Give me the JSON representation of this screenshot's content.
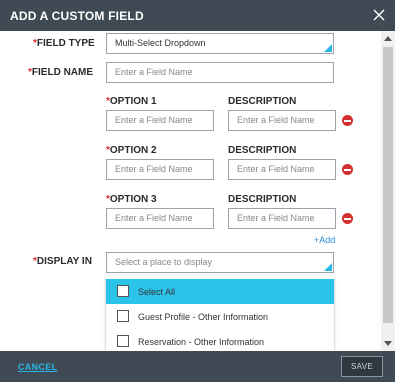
{
  "dialog": {
    "title": "ADD A CUSTOM FIELD"
  },
  "form": {
    "field_type": {
      "label": "FIELD TYPE",
      "value": "Multi-Select Dropdown"
    },
    "field_name": {
      "label": "FIELD NAME",
      "placeholder": "Enter a Field Name"
    },
    "options": [
      {
        "label": "OPTION 1",
        "desc_label": "DESCRIPTION",
        "placeholder": "Enter a Field Name",
        "desc_placeholder": "Enter a Field Name"
      },
      {
        "label": "OPTION 2",
        "desc_label": "DESCRIPTION",
        "placeholder": "Enter a Field Name",
        "desc_placeholder": "Enter a Field Name"
      },
      {
        "label": "OPTION 3",
        "desc_label": "DESCRIPTION",
        "placeholder": "Enter a Field Name",
        "desc_placeholder": "Enter a Field Name"
      }
    ],
    "add_label": "+Add",
    "display_in": {
      "label": "DISPLAY IN",
      "placeholder": "Select a place to display",
      "options": [
        {
          "label": "Select All",
          "highlighted": true,
          "checked": false
        },
        {
          "label": "Guest Profile - Other Information",
          "highlighted": false,
          "checked": false
        },
        {
          "label": "Reservation - Other Information",
          "highlighted": false,
          "checked": false
        }
      ]
    },
    "required_marker": "*"
  },
  "footer": {
    "cancel_label": "CANCEL",
    "save_label": "SAVE"
  },
  "colors": {
    "header_bg": "#3f4a54",
    "accent": "#29b6e6",
    "highlight": "#2cc3e8",
    "required": "#d32f2f",
    "link": "#2a8fd6"
  },
  "icons": {
    "close": "close-icon",
    "remove": "minus-circle-icon",
    "dropdown_indicator": "corner-triangle-icon"
  }
}
